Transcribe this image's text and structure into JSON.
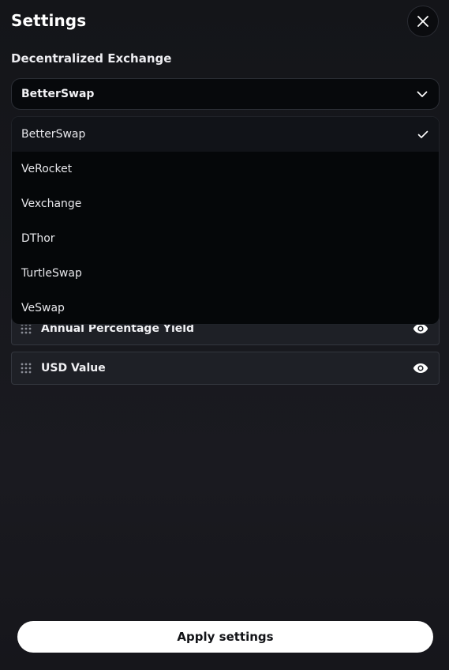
{
  "header": {
    "title": "Settings"
  },
  "exchange": {
    "label": "Decentralized Exchange",
    "selected": "BetterSwap",
    "options": [
      "BetterSwap",
      "VeRocket",
      "Vexchange",
      "DThor",
      "TurtleSwap",
      "VeSwap"
    ]
  },
  "columns": {
    "items": [
      {
        "label": "Annual Percentage Yield"
      },
      {
        "label": "USD Value"
      }
    ]
  },
  "footer": {
    "apply_label": "Apply settings"
  },
  "icons": {
    "close": "close-icon",
    "chevron": "chevron-down-icon",
    "check": "check-icon",
    "drag": "drag-handle-icon",
    "eye": "eye-icon"
  },
  "colors": {
    "background": "#16171c",
    "dropdown_bg": "#050709",
    "row_bg": "#1e2026",
    "button_bg": "#ffffff",
    "button_text": "#121317"
  }
}
